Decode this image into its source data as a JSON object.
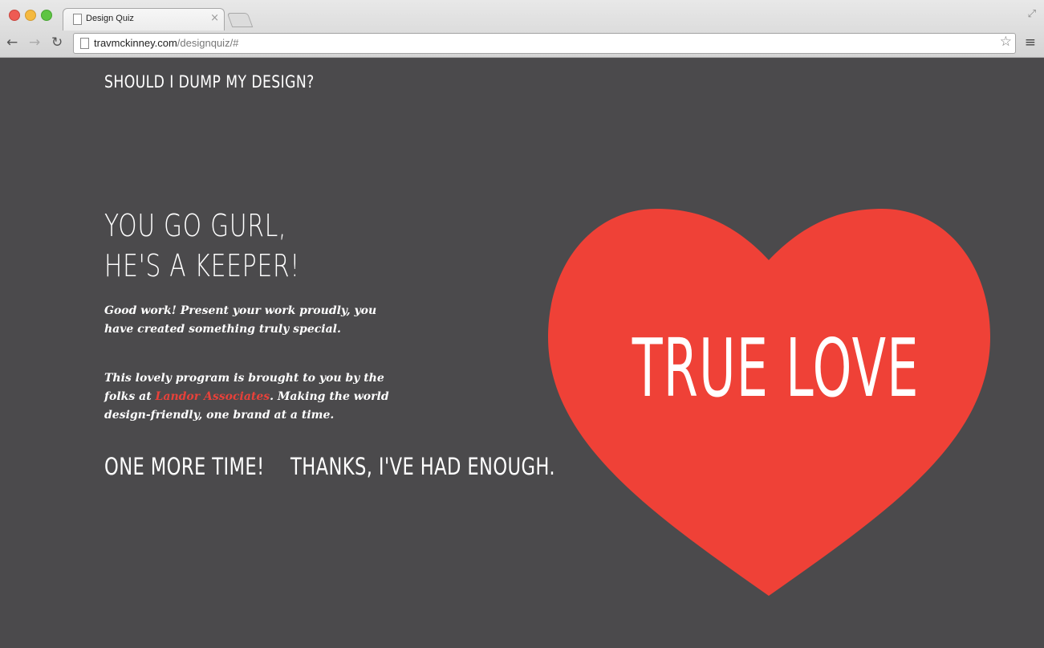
{
  "browser": {
    "tab_title": "Design Quiz",
    "tab_close": "×",
    "url_host": "travmckinney.com",
    "url_path": "/designquiz/#"
  },
  "page": {
    "site_title": "SHOULD I DUMP MY DESIGN?",
    "headline_line1": "YOU GO GURL,",
    "headline_line2": "HE'S A KEEPER!",
    "paragraph1": "Good work! Present your work proudly, you have created something truly special.",
    "paragraph2_before": "This lovely program is brought to you by the folks at ",
    "paragraph2_link": "Landor Associates",
    "paragraph2_after": ". Making the world design-friendly, one brand at a time.",
    "action_again": "ONE MORE TIME!",
    "action_enough": "THANKS, I'VE HAD ENOUGH.",
    "result_label": "TRUE LOVE"
  },
  "colors": {
    "background": "#4b4a4c",
    "heart": "#ef4137",
    "link": "#e8413a"
  },
  "icons": [
    "back-icon",
    "forward-icon",
    "reload-icon",
    "page-icon",
    "bookmark-star-icon",
    "menu-icon",
    "resize-icon"
  ]
}
